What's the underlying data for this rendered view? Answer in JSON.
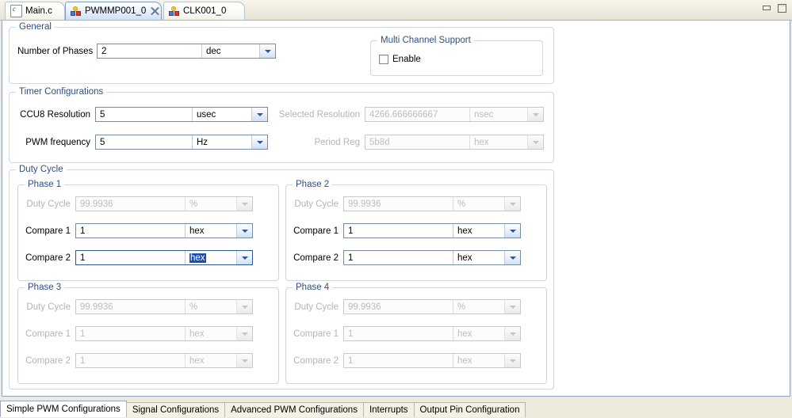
{
  "window": {
    "controls": [
      {
        "name": "minimize-button",
        "icon": "minimize-icon"
      },
      {
        "name": "maximize-button",
        "icon": "maximize-icon"
      }
    ]
  },
  "editor_tabs": [
    {
      "label": "Main.c",
      "icon": "c-file-icon",
      "active": false,
      "closable": false
    },
    {
      "label": "PWMMP001_0",
      "icon": "app-config-icon",
      "active": true,
      "closable": true
    },
    {
      "label": "CLK001_0",
      "icon": "app-config-icon",
      "active": false,
      "closable": false
    }
  ],
  "general": {
    "legend": "General",
    "number_of_phases": {
      "label": "Number of Phases",
      "value": "2",
      "unit": "dec",
      "enabled": true
    }
  },
  "multi_channel": {
    "legend": "Multi Channel Support",
    "enable": {
      "label": "Enable",
      "checked": false
    }
  },
  "timer": {
    "legend": "Timer Configurations",
    "ccu8_resolution": {
      "label": "CCU8 Resolution",
      "value": "5",
      "unit": "usec",
      "enabled": true
    },
    "pwm_frequency": {
      "label": "PWM frequency",
      "value": "5",
      "unit": "Hz",
      "enabled": true
    },
    "selected_resolution": {
      "label": "Selected Resolution",
      "value": "4266.666666667",
      "unit": "nsec",
      "enabled": false
    },
    "period_reg": {
      "label": "Period Reg",
      "value": "5b8d",
      "unit": "hex",
      "enabled": false
    }
  },
  "duty_cycle": {
    "legend": "Duty Cycle",
    "phases": [
      {
        "legend": "Phase 1",
        "duty_cycle": {
          "label": "Duty Cycle",
          "value": "99.9936",
          "unit": "%",
          "enabled": false
        },
        "compare_1": {
          "label": "Compare 1",
          "value": "1",
          "unit": "hex",
          "enabled": true,
          "unit_selected": false
        },
        "compare_2": {
          "label": "Compare 2",
          "value": "1",
          "unit": "hex",
          "enabled": true,
          "unit_selected": true
        }
      },
      {
        "legend": "Phase 2",
        "duty_cycle": {
          "label": "Duty Cycle",
          "value": "99.9936",
          "unit": "%",
          "enabled": false
        },
        "compare_1": {
          "label": "Compare 1",
          "value": "1",
          "unit": "hex",
          "enabled": true,
          "unit_selected": false
        },
        "compare_2": {
          "label": "Compare 2",
          "value": "1",
          "unit": "hex",
          "enabled": true,
          "unit_selected": false
        }
      },
      {
        "legend": "Phase 3",
        "duty_cycle": {
          "label": "Duty Cycle",
          "value": "99.9936",
          "unit": "%",
          "enabled": false
        },
        "compare_1": {
          "label": "Compare 1",
          "value": "1",
          "unit": "hex",
          "enabled": false,
          "unit_selected": false
        },
        "compare_2": {
          "label": "Compare 2",
          "value": "1",
          "unit": "hex",
          "enabled": false,
          "unit_selected": false
        }
      },
      {
        "legend": "Phase 4",
        "duty_cycle": {
          "label": "Duty Cycle",
          "value": "99.9936",
          "unit": "%",
          "enabled": false
        },
        "compare_1": {
          "label": "Compare 1",
          "value": "1",
          "unit": "hex",
          "enabled": false,
          "unit_selected": false
        },
        "compare_2": {
          "label": "Compare 2",
          "value": "1",
          "unit": "hex",
          "enabled": false,
          "unit_selected": false
        }
      }
    ]
  },
  "bottom_tabs": [
    {
      "label": "Simple PWM Configurations",
      "active": true
    },
    {
      "label": "Signal Configurations",
      "active": false
    },
    {
      "label": "Advanced PWM Configurations",
      "active": false
    },
    {
      "label": "Interrupts",
      "active": false
    },
    {
      "label": "Output Pin Configuration",
      "active": false
    }
  ],
  "colors": {
    "accent": "#2f4f7f",
    "selection": "#1f4fa8",
    "group_border": "#cfd6de",
    "window_chrome": "#eceada"
  }
}
